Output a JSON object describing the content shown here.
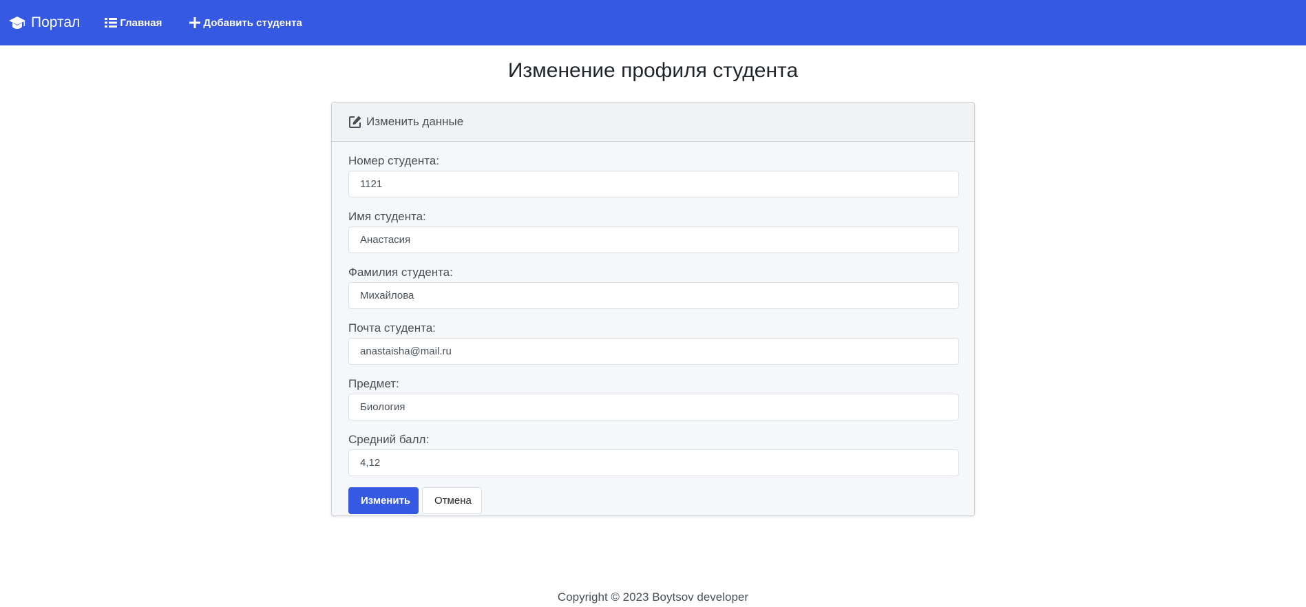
{
  "navbar": {
    "brand": "Портал",
    "brand_icon": "graduation-cap-icon",
    "home_label": "Главная",
    "home_icon": "list-icon",
    "add_label": "Добавить студента",
    "add_icon": "plus-icon",
    "background_color": "#3659e3"
  },
  "page": {
    "title": "Изменение профиля студента"
  },
  "card": {
    "header": "Изменить данные",
    "header_icon": "edit-icon",
    "fields": [
      {
        "label": "Номер студента:",
        "value": "1121"
      },
      {
        "label": "Имя студента:",
        "value": "Анастасия"
      },
      {
        "label": "Фамилия студента:",
        "value": "Михайлова"
      },
      {
        "label": "Почта студента:",
        "value": "anastaisha@mail.ru"
      },
      {
        "label": "Предмет:",
        "value": "Биология"
      },
      {
        "label": "Средний балл:",
        "value": "4,12"
      }
    ],
    "submit_label": "Изменить",
    "cancel_label": "Отмена"
  },
  "footer": {
    "text": "Copyright © 2023 Boytsov developer"
  }
}
